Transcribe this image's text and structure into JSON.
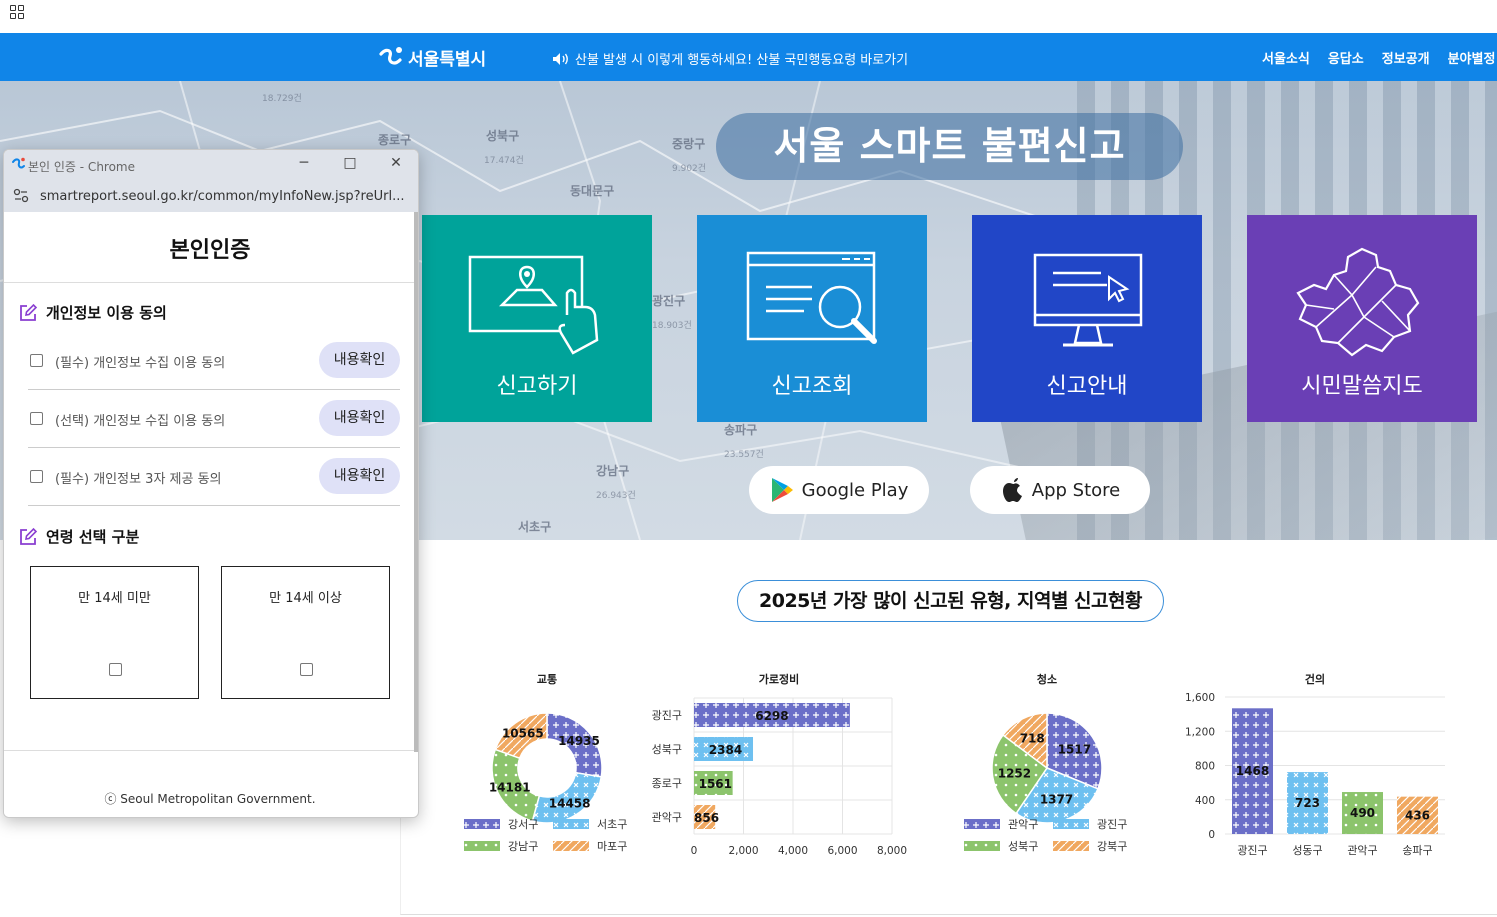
{
  "header": {
    "logo_text": "서울특별시",
    "notice": "산불 발생 시 이렇게 행동하세요! 산불 국민행동요령 바로가기",
    "nav": [
      "서울소식",
      "응답소",
      "정보공개",
      "분야별정"
    ]
  },
  "map_labels": {
    "seongbuk": "성북구",
    "jungnang": "중랑구",
    "dongdaemun": "동대문구",
    "gwangjin": "광진구",
    "songpa": "송파구",
    "gangnam": "강남구",
    "seocho": "서초구",
    "jung": "종로구",
    "n1": "18.729건",
    "n2": "17.474건",
    "n3": "9.902건",
    "n4": "18.903건",
    "n5": "23.557건",
    "n6": "26.943건"
  },
  "hero": {
    "title": "서울 스마트 불편신고",
    "tiles": [
      "신고하기",
      "신고조회",
      "신고안내",
      "시민말씀지도"
    ],
    "tile_colors": [
      "#00a39a",
      "#1a8ed6",
      "#2146c7",
      "#6a3fb5"
    ],
    "google_play": "Google Play",
    "app_store": "App Store"
  },
  "stats_title": "2025년 가장 많이 신고된 유형, 지역별 신고현황",
  "chart_data": [
    {
      "type": "pie",
      "title": "교통",
      "donut": true,
      "categories": [
        "강서구",
        "서초구",
        "강남구",
        "마포구"
      ],
      "values": [
        14935,
        14458,
        14181,
        10565
      ],
      "colors": [
        "#6b6fc8",
        "#6ec0f0",
        "#8cc46c",
        "#f0a860"
      ],
      "legend": "bottom"
    },
    {
      "type": "bar",
      "orientation": "horizontal",
      "title": "가로정비",
      "categories": [
        "광진구",
        "성북구",
        "종로구",
        "관악구"
      ],
      "values": [
        6298,
        2384,
        1561,
        856
      ],
      "colors": [
        "#6b6fc8",
        "#6ec0f0",
        "#8cc46c",
        "#f0a860"
      ],
      "xlim": [
        0,
        8000
      ],
      "xticks": [
        "0",
        "2,000",
        "4,000",
        "6,000",
        "8,000"
      ],
      "grid": true
    },
    {
      "type": "pie",
      "title": "청소",
      "categories": [
        "관악구",
        "광진구",
        "성북구",
        "강북구"
      ],
      "values": [
        1517,
        1377,
        1252,
        718
      ],
      "colors": [
        "#6b6fc8",
        "#6ec0f0",
        "#8cc46c",
        "#f0a860"
      ],
      "legend": "bottom"
    },
    {
      "type": "bar",
      "title": "건의",
      "categories": [
        "광진구",
        "성동구",
        "관악구",
        "송파구"
      ],
      "values": [
        1468,
        723,
        490,
        436
      ],
      "colors": [
        "#6b6fc8",
        "#6ec0f0",
        "#8cc46c",
        "#f0a860"
      ],
      "ylim": [
        0,
        1600
      ],
      "yticks": [
        "0",
        "400",
        "800",
        "1,200",
        "1,600"
      ],
      "grid": true
    }
  ],
  "popup": {
    "window_title": "본인 인증 - Chrome",
    "url": "smartreport.seoul.go.kr/common/myInfoNew.jsp?reUrl...",
    "heading": "본인인증",
    "section_consent": "개인정보 이용 동의",
    "agreements": [
      {
        "text": "(필수) 개인정보 수집 이용 동의",
        "button": "내용확인"
      },
      {
        "text": "(선택) 개인정보 수집 이용 동의",
        "button": "내용확인"
      },
      {
        "text": "(필수) 개인정보 3자 제공 동의",
        "button": "내용확인"
      }
    ],
    "section_age": "연령 선택 구분",
    "age_options": [
      "만 14세 미만",
      "만 14세 이상"
    ],
    "footer": "ⓒ Seoul Metropolitan Government."
  }
}
